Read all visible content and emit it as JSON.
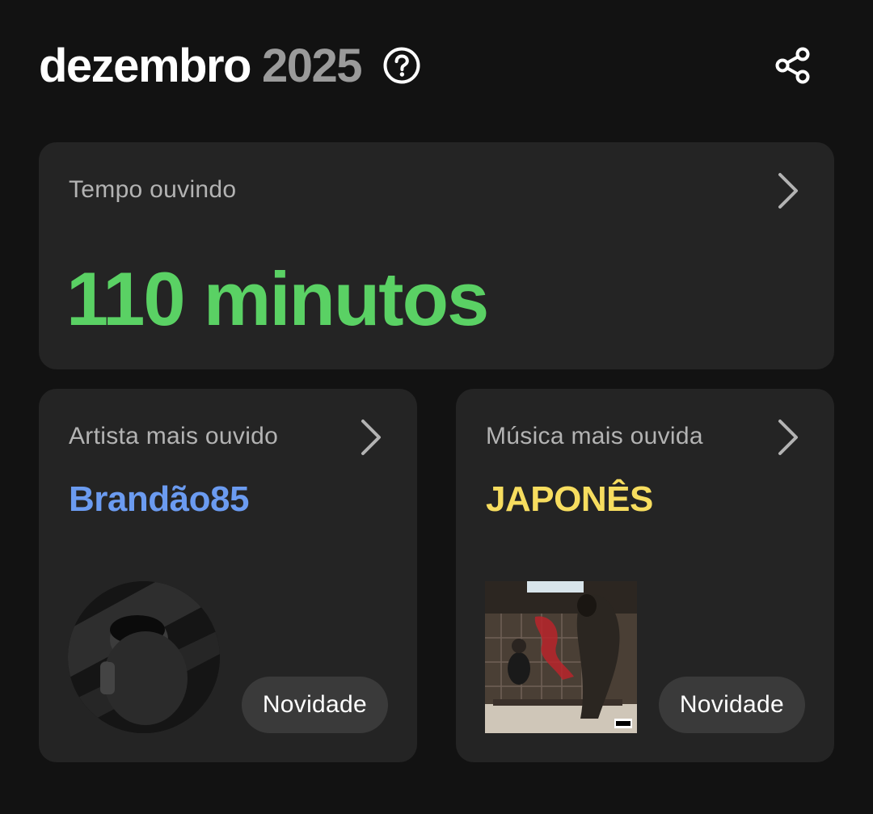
{
  "header": {
    "month": "dezembro",
    "year": "2025",
    "help_icon": "question-circle-icon",
    "share_icon": "share-icon"
  },
  "listening_time": {
    "label": "Tempo ouvindo",
    "value": "110 minutos",
    "accent": "#5ad164"
  },
  "top_artist": {
    "label": "Artista mais ouvido",
    "name": "Brandão85",
    "badge": "Novidade",
    "accent": "#6b9bf0"
  },
  "top_song": {
    "label": "Música mais ouvida",
    "name": "JAPONÊS",
    "badge": "Novidade",
    "accent": "#f7dd5f"
  }
}
